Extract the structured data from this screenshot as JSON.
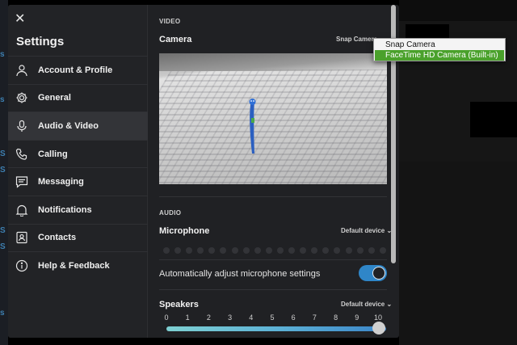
{
  "background": {
    "left_markers": [
      "s",
      "s",
      "S",
      "S",
      "S",
      "S",
      "s"
    ]
  },
  "sidebar": {
    "title": "Settings",
    "close_icon": "close-icon",
    "items": [
      {
        "label": "Account & Profile",
        "icon": "person-icon",
        "active": false
      },
      {
        "label": "General",
        "icon": "gear-icon",
        "active": false
      },
      {
        "label": "Audio & Video",
        "icon": "microphone-icon",
        "active": true
      },
      {
        "label": "Calling",
        "icon": "phone-icon",
        "active": false
      },
      {
        "label": "Messaging",
        "icon": "message-icon",
        "active": false
      },
      {
        "label": "Notifications",
        "icon": "bell-icon",
        "active": false
      },
      {
        "label": "Contacts",
        "icon": "contacts-icon",
        "active": false
      },
      {
        "label": "Help & Feedback",
        "icon": "info-icon",
        "active": false
      }
    ]
  },
  "video": {
    "section": "VIDEO",
    "camera_label": "Camera",
    "camera_select_value": "Snap Camera"
  },
  "camera_dropdown": {
    "options": [
      "Snap Camera",
      "FaceTime HD Camera (Built-in)"
    ],
    "selected_index": 1
  },
  "audio": {
    "section": "AUDIO",
    "microphone_label": "Microphone",
    "microphone_select": "Default device",
    "mic_level_dot_count": 20,
    "auto_adjust_label": "Automatically adjust microphone settings",
    "auto_adjust_enabled": true,
    "speakers_label": "Speakers",
    "speakers_select": "Default device",
    "volume_ticks": [
      "0",
      "1",
      "2",
      "3",
      "4",
      "5",
      "6",
      "7",
      "8",
      "9",
      "10"
    ],
    "volume_value": 10
  },
  "colors": {
    "accent": "#2f86c8",
    "dropdown_highlight": "#4aa12b",
    "dialog_bg": "#202124"
  }
}
